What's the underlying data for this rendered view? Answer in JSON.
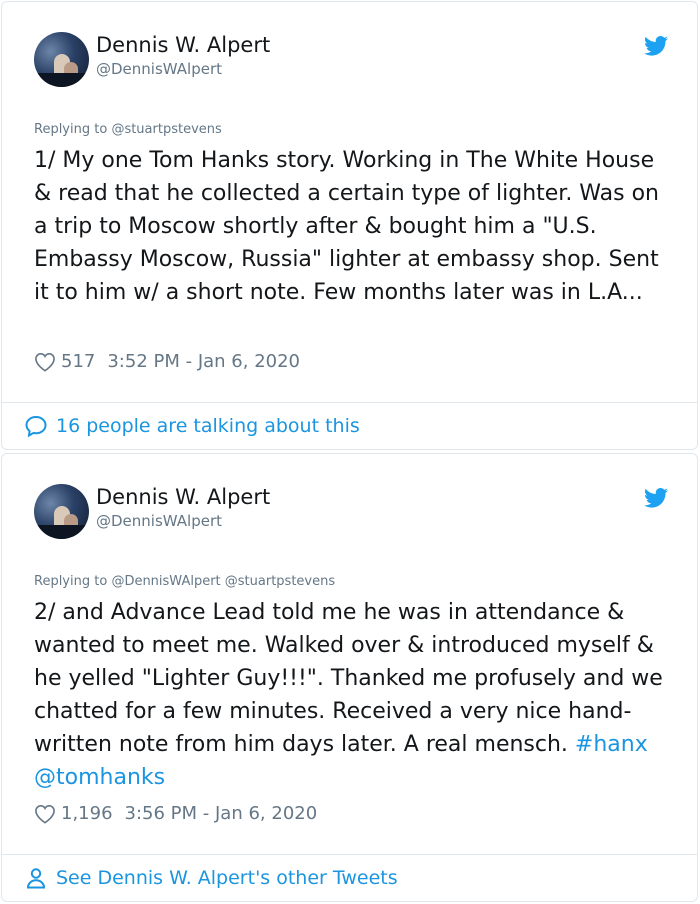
{
  "tweets": [
    {
      "author_name": "Dennis W. Alpert",
      "handle": "@DennisWAlpert",
      "replying_prefix": "Replying to",
      "replying_to": "@stuartpstevens",
      "text": "1/ My one Tom Hanks story. Working in The White House & read that he collected a certain type of lighter. Was on a trip to Moscow shortly after & bought him a \"U.S. Embassy Moscow, Russia\" lighter at embassy shop. Sent it to him w/ a short note. Few months later was in L.A...",
      "likes": "517",
      "timestamp": "3:52 PM - Jan 6, 2020",
      "footer_text": "16 people are talking about this",
      "footer_icon": "speech-bubble-icon"
    },
    {
      "author_name": "Dennis W. Alpert",
      "handle": "@DennisWAlpert",
      "replying_prefix": "Replying to",
      "replying_to": "@DennisWAlpert @stuartpstevens",
      "text": "2/ and Advance Lead told me he was in attendance & wanted to meet me. Walked over & introduced myself & he yelled \"Lighter Guy!!!\". Thanked me profusely and we chatted for a few minutes. Received a very nice hand-written note from him days later. A real mensch.",
      "hashtag": "#hanx",
      "mention": "@tomhanks",
      "likes": "1,196",
      "timestamp": "3:56 PM - Jan 6, 2020",
      "footer_text": "See Dennis W. Alpert's other Tweets",
      "footer_icon": "person-icon"
    }
  ],
  "colors": {
    "link": "#1b95e0",
    "secondary_text": "#657786",
    "border": "#e1e8ed",
    "twitter_blue": "#1da1f2"
  }
}
